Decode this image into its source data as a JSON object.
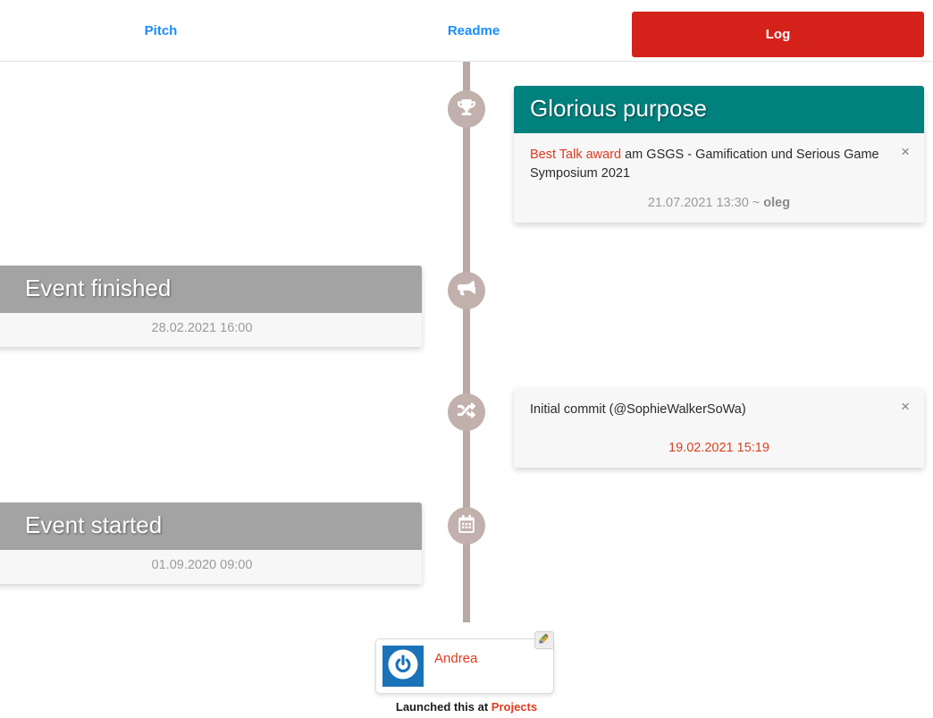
{
  "nav": {
    "tabs": [
      {
        "id": "pitch",
        "label": "Pitch",
        "style": "link"
      },
      {
        "id": "readme",
        "label": "Readme",
        "style": "link"
      },
      {
        "id": "log",
        "label": "Log",
        "style": "active-button"
      }
    ],
    "active_tab": "Log",
    "active_color": "#d4221a",
    "link_color": "#1a8cff"
  },
  "timeline": {
    "line_color": "#b8a9a6",
    "node_color": "#c2b0ad",
    "nodes": [
      {
        "icon": "trophy-icon",
        "label": "award"
      },
      {
        "icon": "megaphone-icon",
        "label": "announcement"
      },
      {
        "icon": "shuffle-icon",
        "label": "commit"
      },
      {
        "icon": "calendar-icon",
        "label": "scheduled"
      }
    ],
    "entries": [
      {
        "id": "glorious",
        "side": "right",
        "title": "Glorious purpose",
        "header_color": "#00817e",
        "text_highlight": "Best Talk award",
        "text_rest": " am GSGS - Gamification und Serious Game Symposium 2021",
        "timestamp": "21.07.2021 13:30 ~ ",
        "author": "oleg",
        "timestamp_color": "#9b9b9b",
        "close_label": "×"
      },
      {
        "id": "finished",
        "side": "left",
        "title": "Event finished",
        "header_color": "#a3a3a3",
        "timestamp": "28.02.2021 16:00",
        "timestamp_color": "#9b9b9b"
      },
      {
        "id": "commit",
        "side": "right",
        "text": "Initial commit (@SophieWalkerSoWa)",
        "timestamp": "19.02.2021 15:19",
        "timestamp_color": "#d9431f",
        "close_label": "×"
      },
      {
        "id": "started",
        "side": "left",
        "title": "Event started",
        "header_color": "#a3a3a3",
        "timestamp": "01.09.2020 09:00",
        "timestamp_color": "#9b9b9b"
      }
    ]
  },
  "footer": {
    "user_name": "Andrea",
    "user_name_color": "#e03a21",
    "avatar_icon": "power-icon",
    "avatar_color": "#1a72b8",
    "edit_icon": "pencil-icon",
    "note_text": "Launched this at ",
    "note_link": "Projects"
  }
}
